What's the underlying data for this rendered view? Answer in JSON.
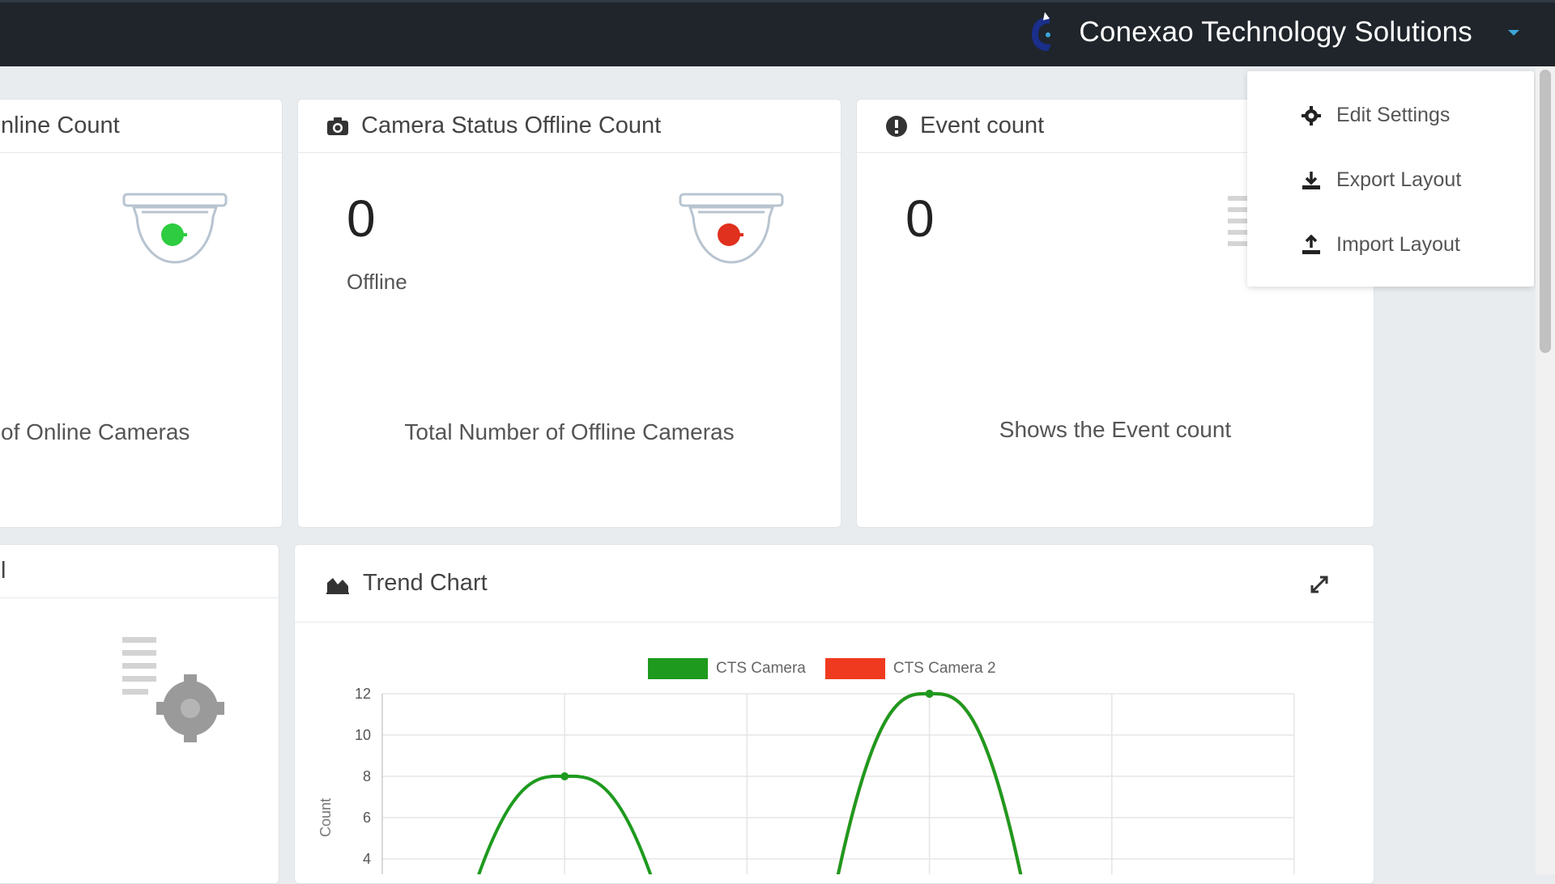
{
  "header": {
    "brand_name": "Conexao Technology Solutions"
  },
  "dropdown": {
    "items": [
      {
        "label": "Edit Settings",
        "icon": "gear-icon"
      },
      {
        "label": "Export Layout",
        "icon": "download-icon"
      },
      {
        "label": "Import Layout",
        "icon": "upload-icon"
      }
    ]
  },
  "cards": {
    "online": {
      "title": "nline Count",
      "description": "of Online Cameras",
      "status_color": "#2ecc40"
    },
    "offline": {
      "title": "Camera Status Offline Count",
      "value": "0",
      "sub_label": "Offline",
      "description": "Total Number of Offline Cameras",
      "status_color": "#e0301e"
    },
    "events": {
      "title": "Event count",
      "value": "0",
      "description": "Shows the Event count"
    },
    "partial": {
      "title": "l"
    },
    "trend": {
      "title": "Trend Chart"
    }
  },
  "chart_data": {
    "type": "line",
    "x": [
      0,
      1,
      2,
      3,
      4,
      5
    ],
    "series": [
      {
        "name": "CTS Camera",
        "color": "#1e9a1e",
        "values": [
          null,
          8,
          null,
          12,
          null,
          null
        ]
      },
      {
        "name": "CTS Camera 2",
        "color": "#f03a20",
        "values": [
          null,
          null,
          null,
          12,
          null,
          null
        ]
      }
    ],
    "y_ticks": [
      "12",
      "10",
      "8",
      "6",
      "4"
    ],
    "ylabel": "Count",
    "ylim": [
      4,
      12
    ],
    "grid": true,
    "legend_position": "top"
  }
}
